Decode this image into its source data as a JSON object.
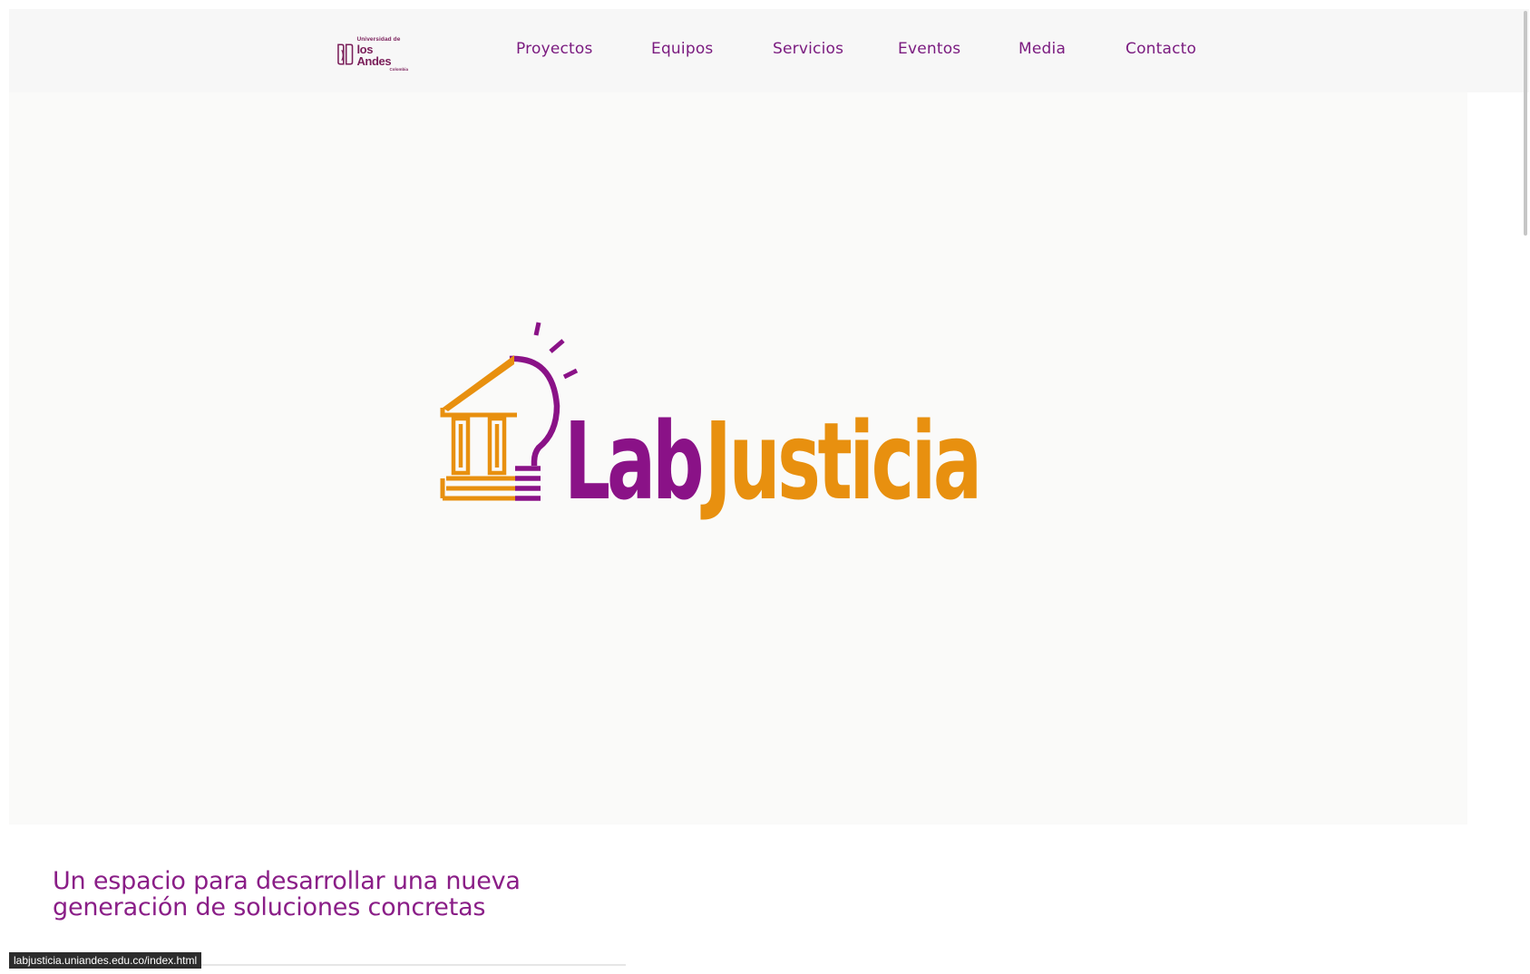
{
  "header": {
    "university_logo": {
      "line1": "Universidad de",
      "line2": "los Andes",
      "line3": "Colombia",
      "icon": "uniandes-crest-icon"
    },
    "nav": [
      {
        "label": "Proyectos"
      },
      {
        "label": "Equipos"
      },
      {
        "label": "Servicios"
      },
      {
        "label": "Eventos"
      },
      {
        "label": "Media"
      },
      {
        "label": "Contacto"
      }
    ]
  },
  "hero": {
    "logo_text_lab": "Lab",
    "logo_text_justicia": "Justicia",
    "logo_icon": "courthouse-lightbulb-icon",
    "colors": {
      "purple": "#8a1287",
      "orange": "#e8900f"
    }
  },
  "intro": {
    "tagline_line1": "Un espacio para desarrollar una nueva",
    "tagline_line2": "generación de soluciones concretas"
  },
  "status_bar": {
    "url": "labjusticia.uniandes.edu.co/index.html"
  },
  "colors": {
    "nav_text": "#7a1a7f",
    "tagline": "#8a1e87",
    "header_bg": "#f7f7f7",
    "hero_bg": "#fafaf9"
  }
}
